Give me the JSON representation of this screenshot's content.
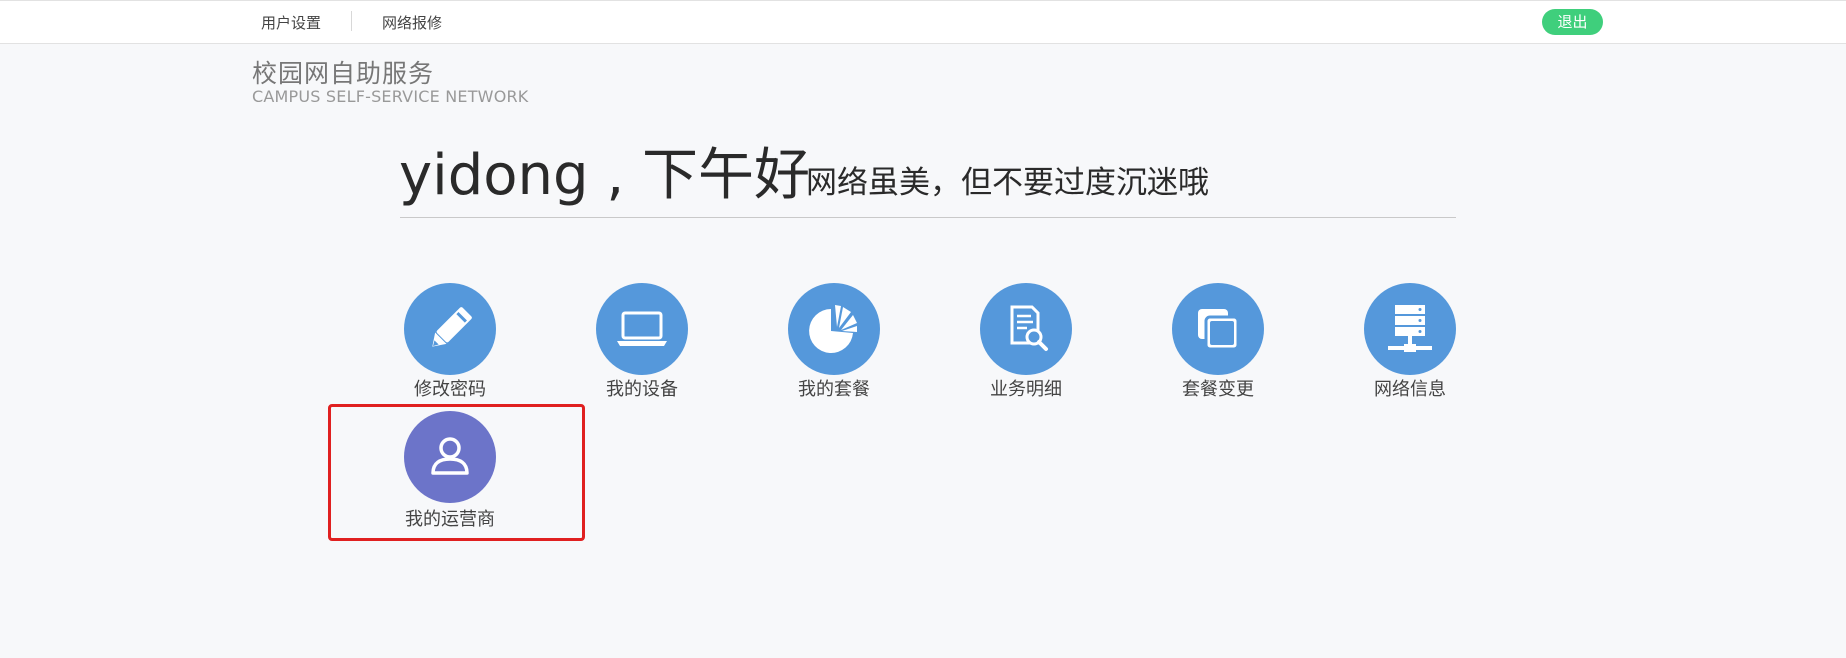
{
  "topbar": {
    "nav": [
      {
        "label": "用户设置"
      },
      {
        "label": "网络报修"
      }
    ],
    "logout_label": "退出"
  },
  "brand": {
    "name_cn": "校园网自助服务",
    "name_en": "CAMPUS  SELF-SERVICE NETWORK"
  },
  "greeting": {
    "text": "yidong , 下午好",
    "slogan": "网络虽美，但不要过度沉迷哦"
  },
  "tiles": [
    {
      "label": "修改密码",
      "icon": "pencil-icon"
    },
    {
      "label": "我的设备",
      "icon": "laptop-icon"
    },
    {
      "label": "我的套餐",
      "icon": "pie-chart-icon"
    },
    {
      "label": "业务明细",
      "icon": "document-search-icon"
    },
    {
      "label": "套餐变更",
      "icon": "switch-package-icon"
    },
    {
      "label": "网络信息",
      "icon": "server-icon"
    },
    {
      "label": "我的运营商",
      "icon": "user-icon"
    }
  ],
  "colors": {
    "tile_blue": "#5598db",
    "tile_purple": "#6c74c9",
    "logout_green": "#3fcf7c",
    "highlight_red": "#e02020"
  }
}
